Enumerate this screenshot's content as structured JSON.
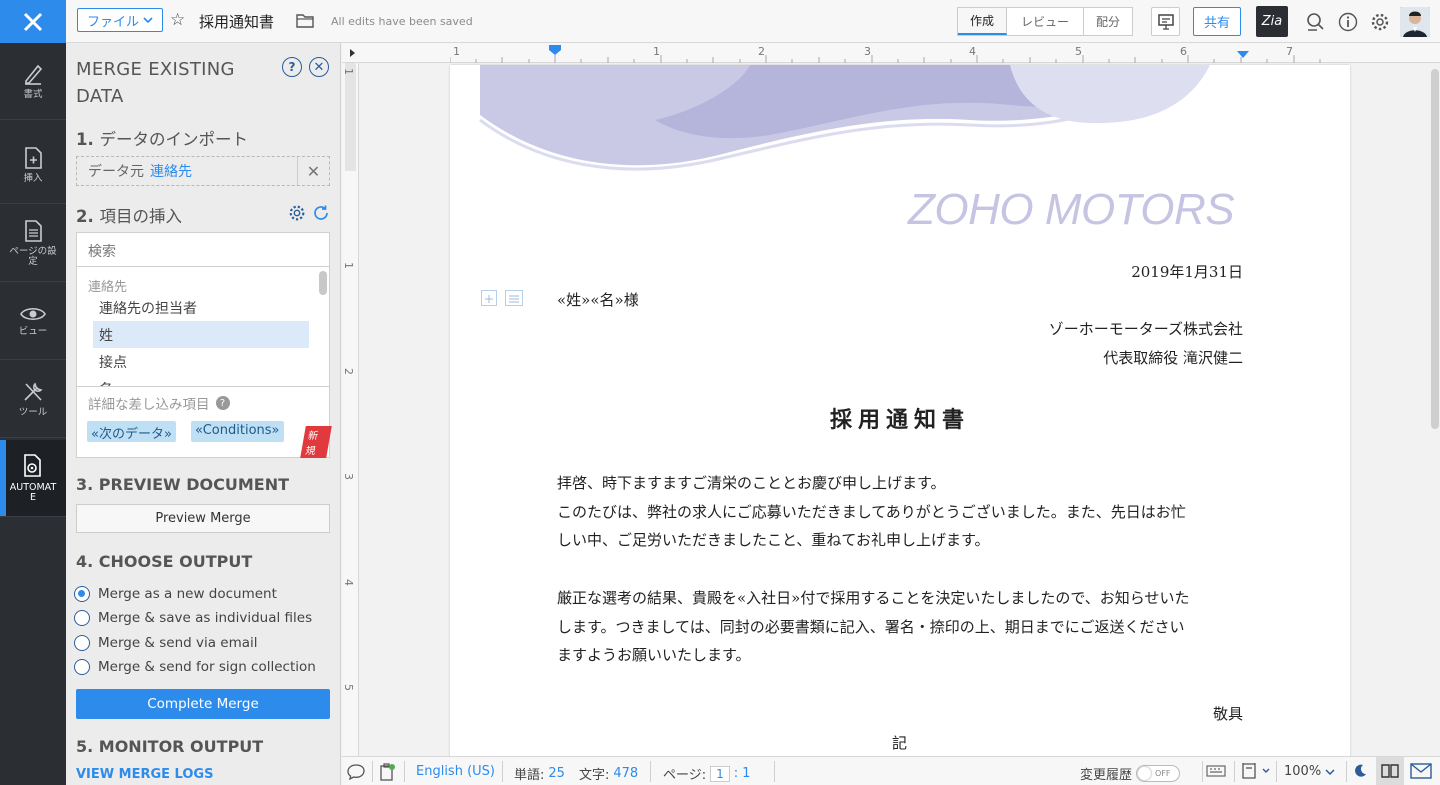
{
  "topbar": {
    "file_menu": "ファイル",
    "doc_title": "採用通知書",
    "saved_status": "All edits have been saved",
    "modes": [
      "作成",
      "レビュー",
      "配分"
    ],
    "share": "共有",
    "zia": "Zia"
  },
  "rail": {
    "items": [
      "書式",
      "挿入",
      "ページの設定",
      "ビュー",
      "ツール",
      "AUTOMATE"
    ]
  },
  "panel": {
    "title": "MERGE EXISTING DATA",
    "step1": {
      "num": "1.",
      "label": "データのインポート"
    },
    "source_label": "データ元",
    "source_value": "連絡先",
    "step2": {
      "num": "2.",
      "label": "項目の挿入"
    },
    "search_placeholder": "検索",
    "field_group": "連絡先",
    "fields": [
      "連絡先の担当者",
      "姓",
      "接点",
      "名"
    ],
    "advanced_label": "詳細な差し込み項目",
    "chips": [
      "«次のデータ»",
      "«Conditions»"
    ],
    "new_tag": "新規",
    "step3": "3. PREVIEW DOCUMENT",
    "preview_button": "Preview Merge",
    "step4": "4. CHOOSE OUTPUT",
    "options": [
      "Merge as a new document",
      "Merge & save as individual files",
      "Merge & send via email",
      "Merge & send for sign collection"
    ],
    "selected_option": 0,
    "complete_button": "Complete Merge",
    "step5": "5. MONITOR OUTPUT",
    "logs_link": "VIEW MERGE LOGS"
  },
  "ruler": {
    "h_labels": [
      "1",
      "1",
      "2",
      "3",
      "4",
      "5",
      "6",
      "7"
    ],
    "v_labels": [
      "1",
      "1",
      "2",
      "3",
      "4",
      "5"
    ]
  },
  "document": {
    "brand": "ZOHO MOTORS",
    "date": "2019年1月31日",
    "recipient": "«姓»«名»様",
    "company": "ゾーホーモーターズ株式会社",
    "representative": "代表取締役 滝沢健二",
    "title": "採用通知書",
    "para1": "拝啓、時下ますますご清栄のこととお慶び申し上げます。",
    "para2_l1": "このたびは、弊社の求人にご応募いただきましてありがとうございました。また、先日はお忙",
    "para2_l2": "しい中、ご足労いただきましたこと、重ねてお礼申し上げます。",
    "para3_l1": "厳正な選考の結果、貴殿を«入社日»付で採用することを決定いたしましたので、お知らせいた",
    "para3_l2": "します。つきましては、同封の必要書類に記入、署名・捺印の上、期日までにご返送ください",
    "para3_l3": "ますようお願いいたします。",
    "closing": "敬具",
    "ki": "記"
  },
  "status": {
    "language": "English (US)",
    "words_label": "単語:",
    "words": "25",
    "chars_label": "文字:",
    "chars": "478",
    "page_label": "ページ:",
    "page_current": "1",
    "page_total": "1",
    "track_changes": "変更履歴",
    "toggle": "OFF",
    "zoom": "100%"
  },
  "colors": {
    "accent": "#2d8ceb",
    "rail": "#2b2e33",
    "brand_wave": "#c5c5e3"
  }
}
